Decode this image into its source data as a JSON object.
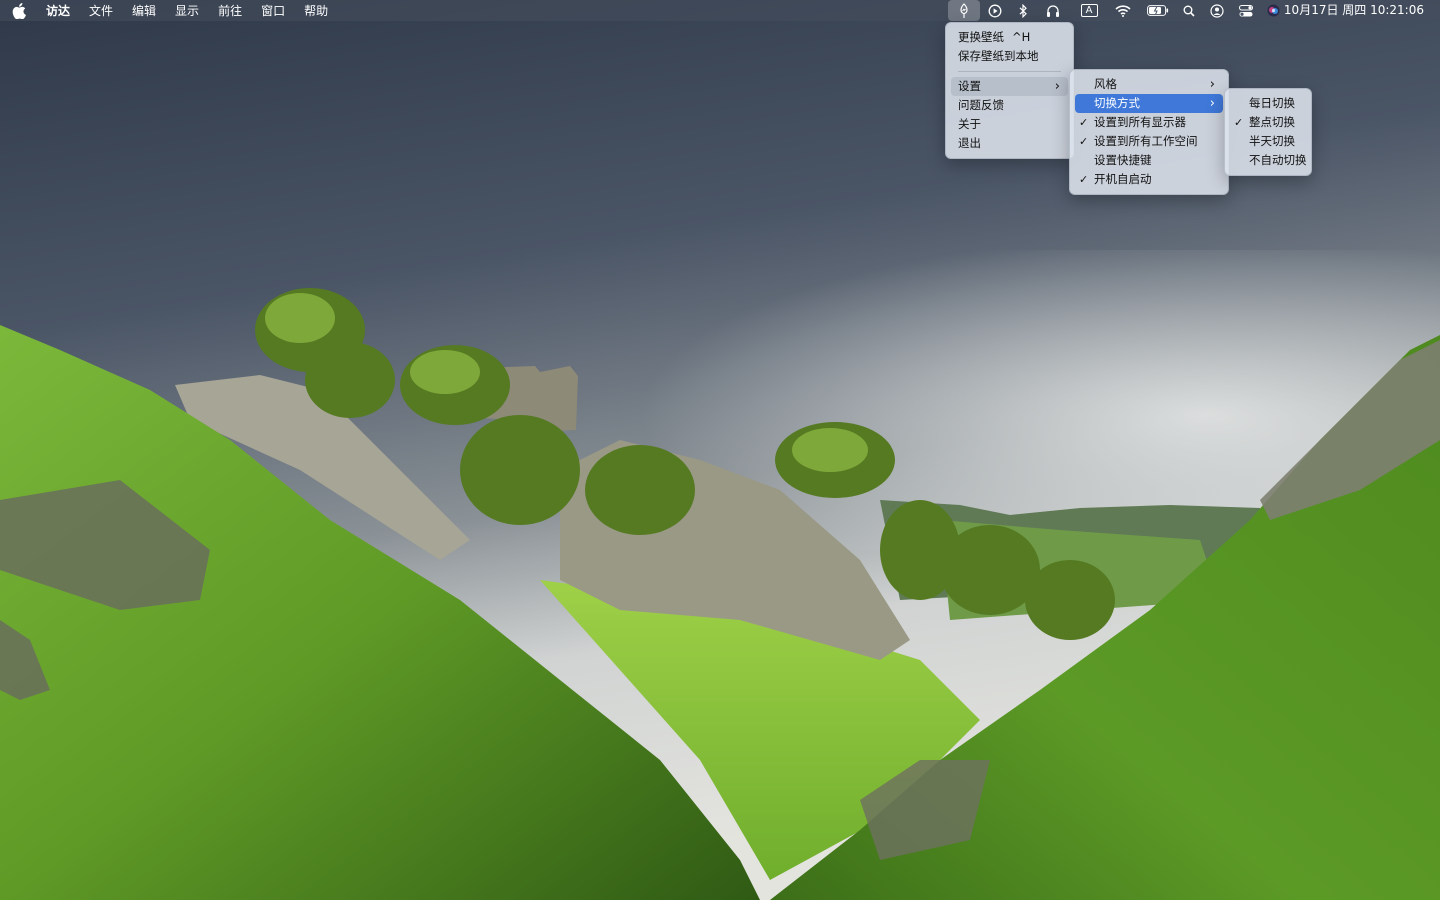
{
  "menubar": {
    "app_name": "访达",
    "menus": [
      "文件",
      "编辑",
      "显示",
      "前往",
      "窗口",
      "帮助"
    ],
    "tray_icons": [
      "wallpaper-app-icon",
      "play-circle-icon",
      "bluetooth-icon",
      "headphones-icon",
      "input-method-icon",
      "wifi-icon",
      "battery-icon",
      "search-icon",
      "user-icon",
      "control-center-icon",
      "siri-icon"
    ],
    "input_method_label": "A",
    "clock": "10月17日 周四  10:21:06"
  },
  "main_menu": {
    "items": [
      {
        "label": "更换壁纸",
        "shortcut": "^H"
      },
      {
        "label": "保存壁纸到本地"
      }
    ],
    "items2": [
      {
        "label": "设置",
        "submenu": true
      },
      {
        "label": "问题反馈"
      },
      {
        "label": "关于"
      },
      {
        "label": "退出"
      }
    ]
  },
  "settings_menu": {
    "items": [
      {
        "label": "风格",
        "submenu": true,
        "checked": false
      },
      {
        "label": "切换方式",
        "submenu": true,
        "checked": false
      },
      {
        "label": "设置到所有显示器",
        "checked": true
      },
      {
        "label": "设置到所有工作空间",
        "checked": true
      },
      {
        "label": "设置快捷键",
        "checked": false
      },
      {
        "label": "开机自启动",
        "checked": true
      }
    ]
  },
  "switch_menu": {
    "items": [
      {
        "label": "每日切换",
        "checked": false
      },
      {
        "label": "整点切换",
        "checked": true
      },
      {
        "label": "半天切换",
        "checked": false
      },
      {
        "label": "不自动切换",
        "checked": false
      }
    ]
  },
  "colors": {
    "highlight": "#3f78d9",
    "menu_bg": "#dde2ec",
    "sky_dark": "#3c4656",
    "sky_light": "#c9ccce",
    "grass": "#6fae2c"
  }
}
